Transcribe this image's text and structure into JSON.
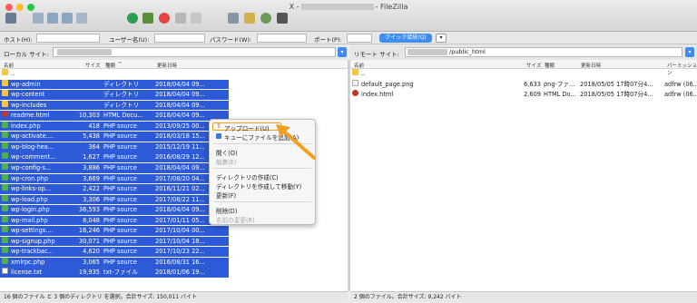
{
  "window": {
    "title_prefix": "X -",
    "title_suffix": "- FileZilla"
  },
  "quickconnect": {
    "host_label": "ホスト(H):",
    "user_label": "ユーザー名(U):",
    "pass_label": "パスワード(W):",
    "port_label": "ポート(P):",
    "connect_button": "クイック接続(Q)",
    "dropdown": "▾"
  },
  "local": {
    "site_label": "ローカル サイト:",
    "site_value": "",
    "columns": {
      "name": "名前",
      "size": "サイズ",
      "type": "種類",
      "date": "更新日時"
    },
    "rows": [
      {
        "name": "..",
        "size": "",
        "type": "",
        "date": ""
      },
      {
        "name": "wp-admin",
        "size": "",
        "type": "ディレクトリ",
        "date": "2018/04/04 09..."
      },
      {
        "name": "wp-content",
        "size": "",
        "type": "ディレクトリ",
        "date": "2018/04/04 09..."
      },
      {
        "name": "wp-includes",
        "size": "",
        "type": "ディレクトリ",
        "date": "2018/04/04 09..."
      },
      {
        "name": "readme.html",
        "size": "10,303",
        "type": "HTML Docu...",
        "date": "2018/04/04 09..."
      },
      {
        "name": "index.php",
        "size": "418",
        "type": "PHP source",
        "date": "2013/09/25 00..."
      },
      {
        "name": "wp-activate....",
        "size": "5,438",
        "type": "PHP source",
        "date": "2018/03/18 15..."
      },
      {
        "name": "wp-blog-hea...",
        "size": "364",
        "type": "PHP source",
        "date": "2015/12/19 11..."
      },
      {
        "name": "wp-comment...",
        "size": "1,627",
        "type": "PHP source",
        "date": "2016/08/29 12..."
      },
      {
        "name": "wp-config-s...",
        "size": "3,886",
        "type": "PHP source",
        "date": "2018/04/04 09..."
      },
      {
        "name": "wp-cron.php",
        "size": "3,669",
        "type": "PHP source",
        "date": "2017/08/20 04..."
      },
      {
        "name": "wp-links-op...",
        "size": "2,422",
        "type": "PHP source",
        "date": "2016/11/21 02..."
      },
      {
        "name": "wp-load.php",
        "size": "3,306",
        "type": "PHP source",
        "date": "2017/08/22 11..."
      },
      {
        "name": "wp-login.php",
        "size": "36,593",
        "type": "PHP source",
        "date": "2018/04/04 09..."
      },
      {
        "name": "wp-mail.php",
        "size": "8,048",
        "type": "PHP source",
        "date": "2017/01/11 05..."
      },
      {
        "name": "wp-settings....",
        "size": "16,246",
        "type": "PHP source",
        "date": "2017/10/04 00..."
      },
      {
        "name": "wp-signup.php",
        "size": "30,071",
        "type": "PHP source",
        "date": "2017/10/04 18..."
      },
      {
        "name": "wp-trackbac...",
        "size": "4,620",
        "type": "PHP source",
        "date": "2017/10/23 22..."
      },
      {
        "name": "xmlrpc.php",
        "size": "3,065",
        "type": "PHP source",
        "date": "2016/08/31 16..."
      },
      {
        "name": "license.txt",
        "size": "19,935",
        "type": "txt-ファイル",
        "date": "2018/01/06 19..."
      }
    ],
    "status": "16 個のファイル と 3 個のディレクトリ を選択。合計サイズ: 150,011 バイト"
  },
  "remote": {
    "site_label": "リモート サイト:",
    "site_value": "/public_html",
    "columns": {
      "name": "名前",
      "size": "サイズ",
      "type": "種類",
      "date": "更新日時",
      "perm": "パーミッション"
    },
    "rows": [
      {
        "name": "..",
        "size": "",
        "type": "",
        "date": "",
        "perm": ""
      },
      {
        "name": "default_page.png",
        "size": "6,633",
        "type": "png-ファ...",
        "date": "2018/05/05 17時07分4...",
        "perm": "adfrw (06..."
      },
      {
        "name": "index.html",
        "size": "2,609",
        "type": "HTML Do...",
        "date": "2018/05/05 17時07分4...",
        "perm": "adfrw (06..."
      }
    ],
    "status": "2 個のファイル。合計サイズ: 9,242 バイト"
  },
  "context_menu": {
    "items": [
      {
        "label": "アップロード(U)",
        "enabled": true
      },
      {
        "label": "キューにファイルを追加(A)",
        "enabled": true
      },
      {
        "label": "開く(O)",
        "enabled": true
      },
      {
        "label": "編集(E)",
        "enabled": false
      },
      {
        "label": "ディレクトリの作成(C)",
        "enabled": true
      },
      {
        "label": "ディレクトリを作成して移動(Y)",
        "enabled": true
      },
      {
        "label": "更新(F)",
        "enabled": true
      },
      {
        "label": "削除(D)",
        "enabled": true
      },
      {
        "label": "名前の変更(R)",
        "enabled": false
      }
    ]
  },
  "colors": {
    "selection": "#2d5bd7",
    "accent": "#3d8ef0",
    "arrow": "#f0a020"
  }
}
